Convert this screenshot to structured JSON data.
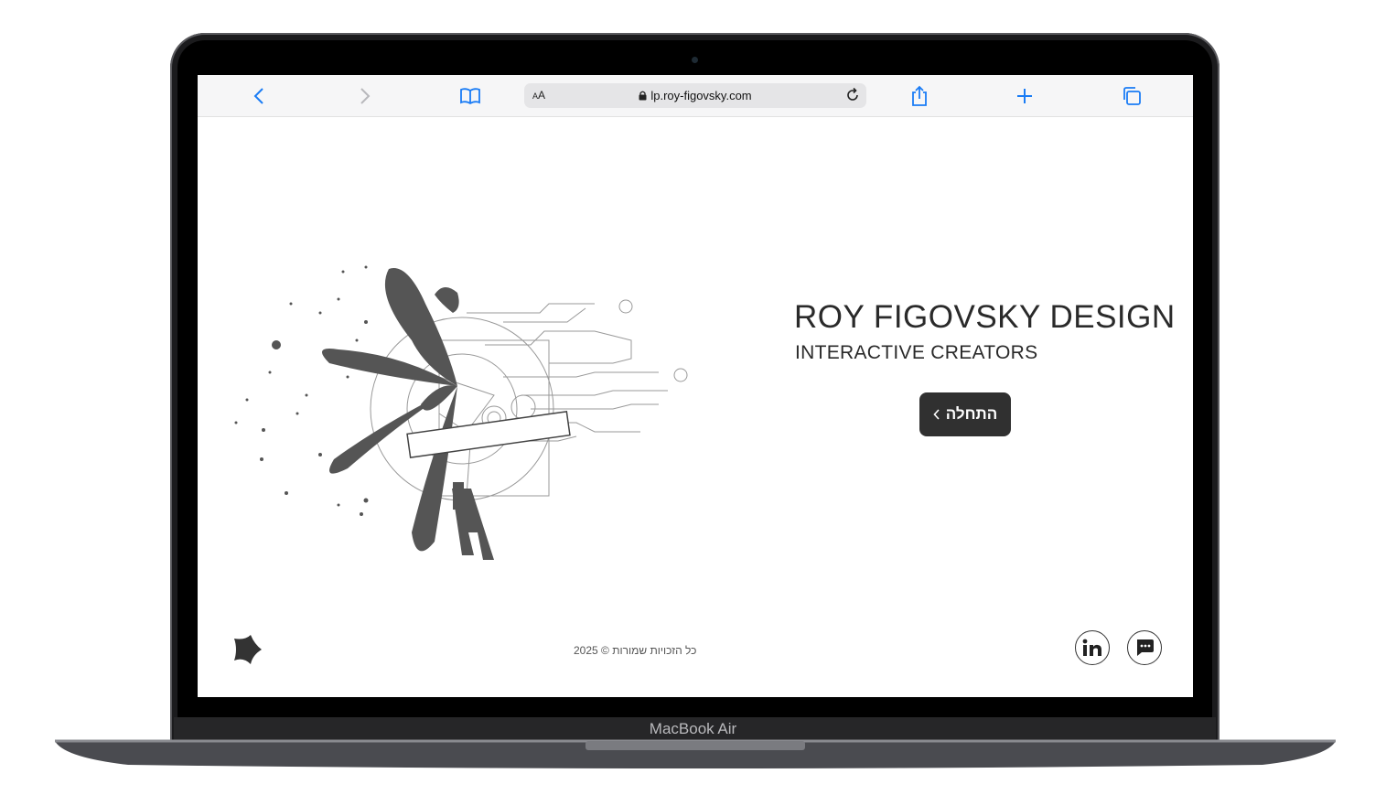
{
  "device": {
    "label": "MacBook Air"
  },
  "browser": {
    "url": "lp.roy-figovsky.com",
    "reader_label_small": "A",
    "reader_label": "A"
  },
  "page": {
    "title": "ROY FIGOVSKY DESIGN",
    "subtitle": "INTERACTIVE CREATORS",
    "cta_label": "התחלה",
    "cta_icon": "chevron-left-icon",
    "copyright": "כל הזכויות שמורות © 2025",
    "social": [
      "linkedin-icon",
      "chat-icon"
    ]
  },
  "colors": {
    "accent": "#1a7cf5",
    "button": "#303030",
    "text": "#2a2a2a"
  }
}
